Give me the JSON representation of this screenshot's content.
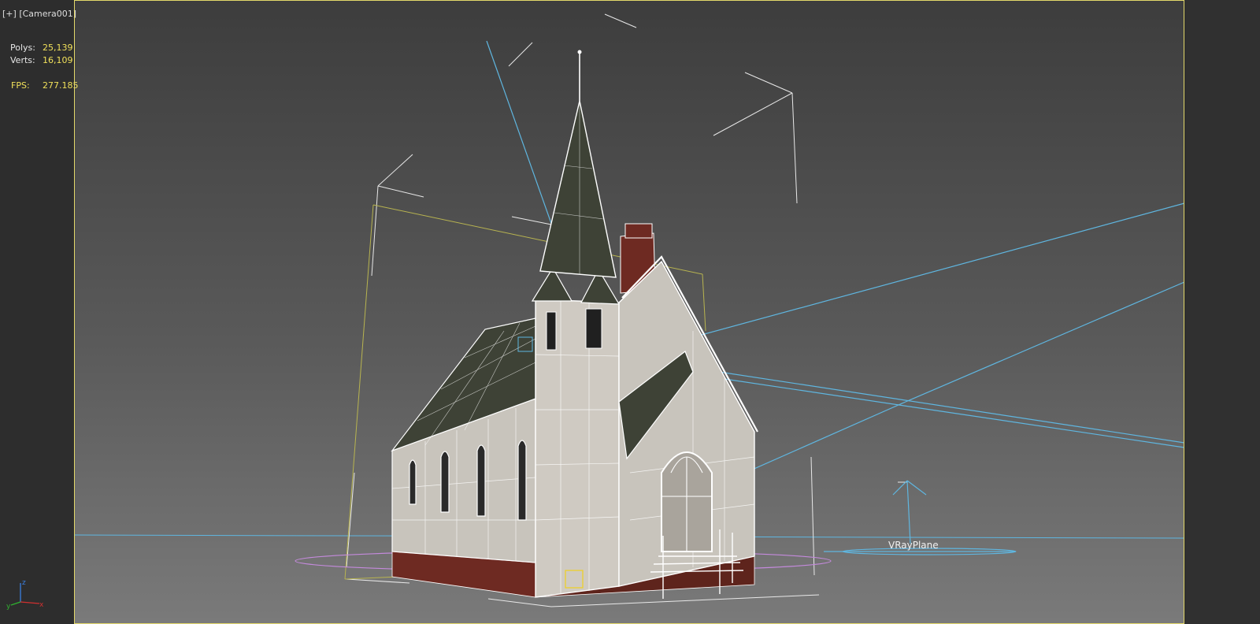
{
  "viewport": {
    "menu": "[+]",
    "camera": "[Camera001]"
  },
  "stats": {
    "polys_label": "Polys:",
    "polys_value": "25,139",
    "verts_label": "Verts:",
    "verts_value": "16,109",
    "fps_label": "FPS:",
    "fps_value": "277.185"
  },
  "scene": {
    "plane_label": "VRayPlane",
    "axis_z": "z",
    "axis_x": "x",
    "axis_y": "y"
  },
  "colors": {
    "frame": "#e3d86a",
    "stat_value": "#f0e05a",
    "light_lines": "#5fb6e0",
    "bounding_box": "#b8b450",
    "ground_ellipse": "#c48adc",
    "brick": "#6e2a22",
    "roof": "#3e4236",
    "walls": "#c8c4bc"
  }
}
